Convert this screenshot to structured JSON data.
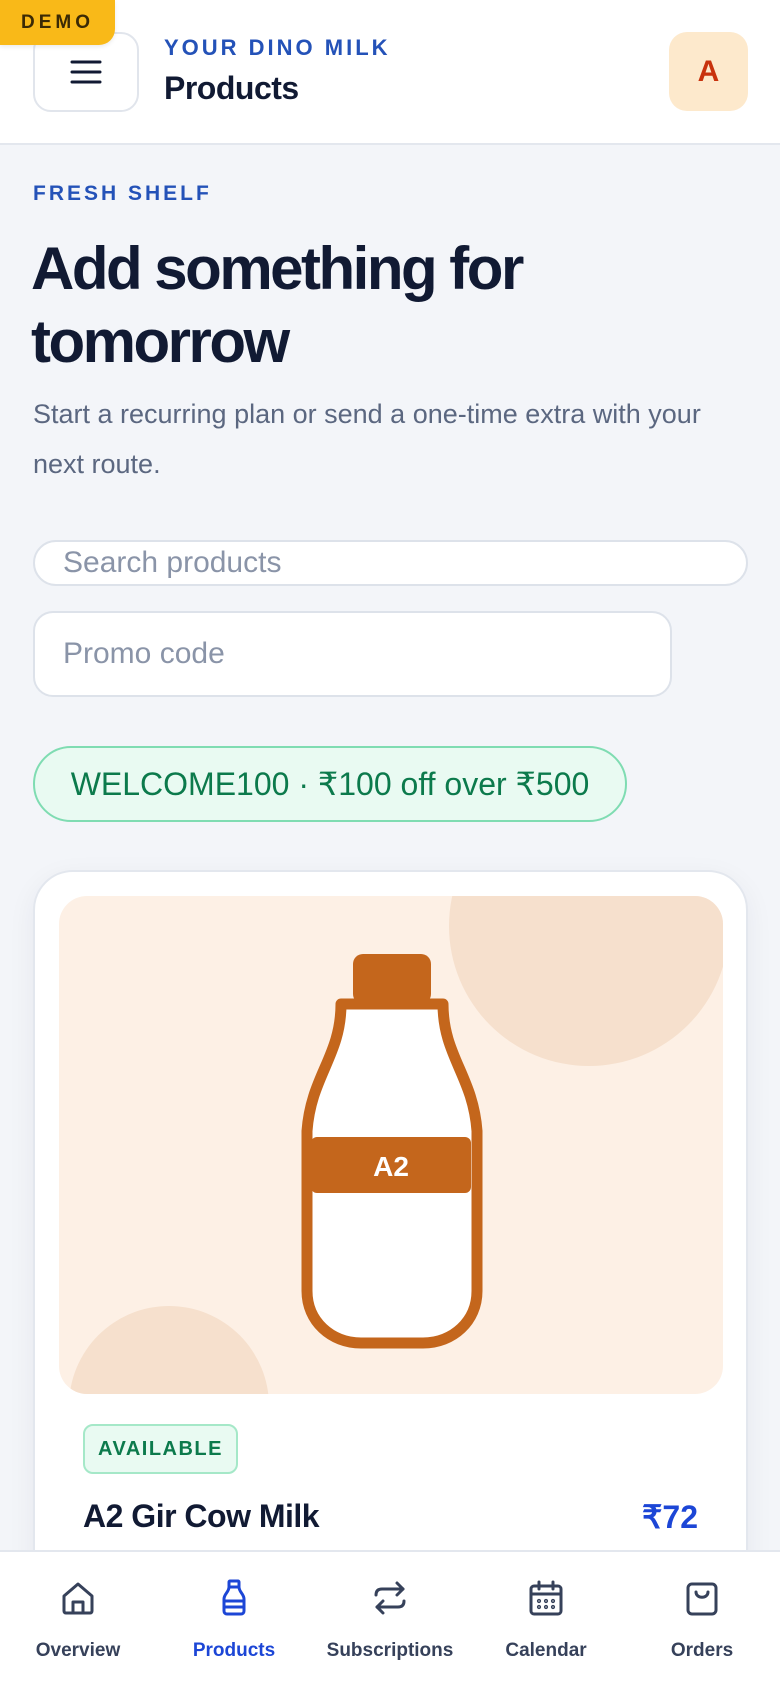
{
  "demo_badge": "DEMO",
  "header": {
    "brand": "YOUR DINO MILK",
    "title": "Products",
    "avatar_initial": "A",
    "menu_icon": "hamburger-menu-icon"
  },
  "hero": {
    "eyebrow": "FRESH SHELF",
    "title": "Add something for tomorrow",
    "subtitle": "Start a recurring plan or send a one-time extra with your next route."
  },
  "search": {
    "placeholder": "Search products",
    "value": ""
  },
  "promo_input": {
    "placeholder": "Promo code",
    "value": ""
  },
  "promo_chip": "WELCOME100 · ₹100 off over ₹500",
  "product": {
    "image_label": "A2",
    "status": "AVAILABLE",
    "name": "A2 Gir Cow Milk",
    "price": "₹72",
    "icon": "milk-bottle-icon"
  },
  "nav": {
    "items": [
      {
        "label": "Overview",
        "icon": "home-icon",
        "active": false
      },
      {
        "label": "Products",
        "icon": "bottle-icon",
        "active": true
      },
      {
        "label": "Subscriptions",
        "icon": "repeat-icon",
        "active": false
      },
      {
        "label": "Calendar",
        "icon": "calendar-icon",
        "active": false
      },
      {
        "label": "Orders",
        "icon": "shopping-bag-icon",
        "active": false
      }
    ]
  },
  "colors": {
    "accent_blue": "#2452b8",
    "active_blue": "#1c46d6",
    "heading": "#111a33",
    "demo_yellow": "#f9b918",
    "success_green": "#0c7a4c",
    "bottle_orange": "#c4661c"
  }
}
